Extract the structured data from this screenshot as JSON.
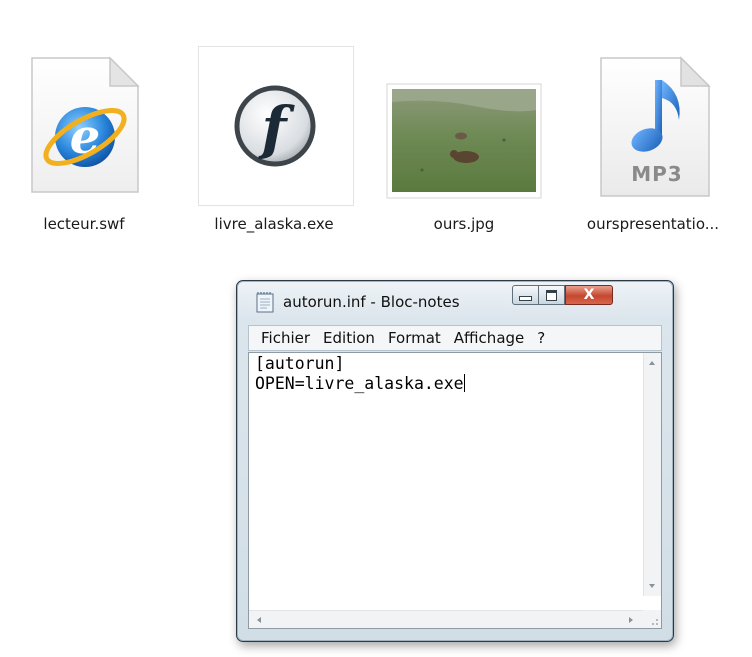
{
  "files": [
    {
      "name": "lecteur.swf",
      "icon": "internet-explorer-icon"
    },
    {
      "name": "livre_alaska.exe",
      "icon": "flash-player-icon"
    },
    {
      "name": "ours.jpg",
      "icon": "photo-thumbnail"
    },
    {
      "name": "ourspresentatio...",
      "icon": "mp3-file-icon",
      "badge": "MP3"
    }
  ],
  "notepad": {
    "title": "autorun.inf - Bloc-notes",
    "controls": {
      "close_glyph": "X"
    },
    "menu": [
      "Fichier",
      "Edition",
      "Format",
      "Affichage",
      "?"
    ],
    "content_lines": [
      "[autorun]",
      "OPEN=livre_alaska.exe"
    ]
  },
  "colors": {
    "ie_blue": "#1f6fcf",
    "ie_gold": "#f2b01e",
    "mp3_note": "#2f7fd6",
    "close_button": "#c5482f"
  }
}
